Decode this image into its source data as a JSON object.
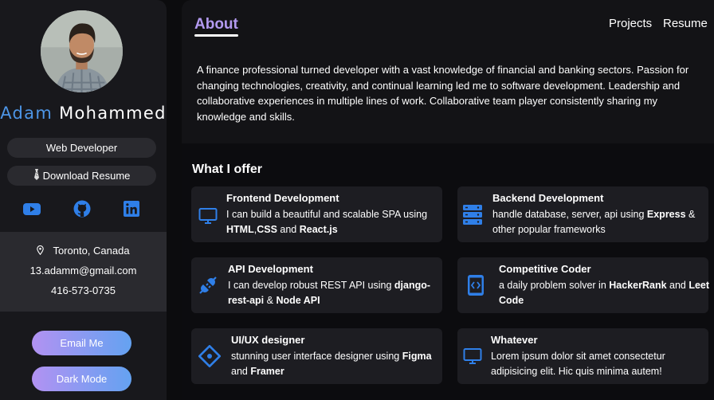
{
  "profile": {
    "first_name": "Adam",
    "last_name": "Mohammed",
    "role": "Web Developer",
    "download_label": "Download Resume",
    "location": "Toronto, Canada",
    "email": "13.adamm@gmail.com",
    "phone": "416-573-0735"
  },
  "socials": [
    "youtube-icon",
    "github-icon",
    "linkedin-icon"
  ],
  "buttons": {
    "email": "Email Me",
    "dark_mode": "Dark Mode"
  },
  "nav": {
    "about": "About",
    "projects": "Projects",
    "resume": "Resume"
  },
  "intro": "A finance professional turned developer with a vast knowledge of financial and banking sectors. Passion for changing technologies, creativity, and continual learning led me to software development. Leadership and collaborative experiences in multiple lines of work. Collaborative team player consistently sharing my knowledge and skills.",
  "offer": {
    "title": "What I offer",
    "cards": [
      {
        "icon": "monitor-icon",
        "title": "Frontend Development",
        "desc": [
          {
            "t": "I can build a beautiful and scalable SPA using "
          },
          {
            "t": "HTML",
            "b": true
          },
          {
            "t": ","
          },
          {
            "t": "CSS",
            "b": true
          },
          {
            "t": " and "
          },
          {
            "t": "React.js",
            "b": true
          }
        ]
      },
      {
        "icon": "server-icon",
        "title": "Backend Development",
        "desc": [
          {
            "t": "handle database, server, api using "
          },
          {
            "t": "Express",
            "b": true
          },
          {
            "t": " & other popular frameworks"
          }
        ]
      },
      {
        "icon": "plug-icon",
        "title": "API Development",
        "desc": [
          {
            "t": "I can develop robust REST API using "
          },
          {
            "t": "django-rest-api",
            "b": true
          },
          {
            "t": " & "
          },
          {
            "t": "Node API",
            "b": true
          }
        ]
      },
      {
        "icon": "code-phone-icon",
        "title": "Competitive Coder",
        "desc": [
          {
            "t": "a daily problem solver in "
          },
          {
            "t": "HackerRank",
            "b": true
          },
          {
            "t": " and "
          },
          {
            "t": "Leet Code",
            "b": true
          }
        ]
      },
      {
        "icon": "diamond-icon",
        "title": "UI/UX designer",
        "desc": [
          {
            "t": "stunning user interface designer using "
          },
          {
            "t": "Figma",
            "b": true
          },
          {
            "t": " and "
          },
          {
            "t": "Framer",
            "b": true
          }
        ]
      },
      {
        "icon": "monitor-icon",
        "title": "Whatever",
        "desc": [
          {
            "t": "Lorem ipsum dolor sit amet consectetur adipisicing elit. Hic quis minima autem!"
          }
        ]
      }
    ]
  },
  "colors": {
    "accent_blue": "#4d95e6",
    "accent_purple": "#b39af0",
    "icon_blue": "#2f7fe8"
  }
}
